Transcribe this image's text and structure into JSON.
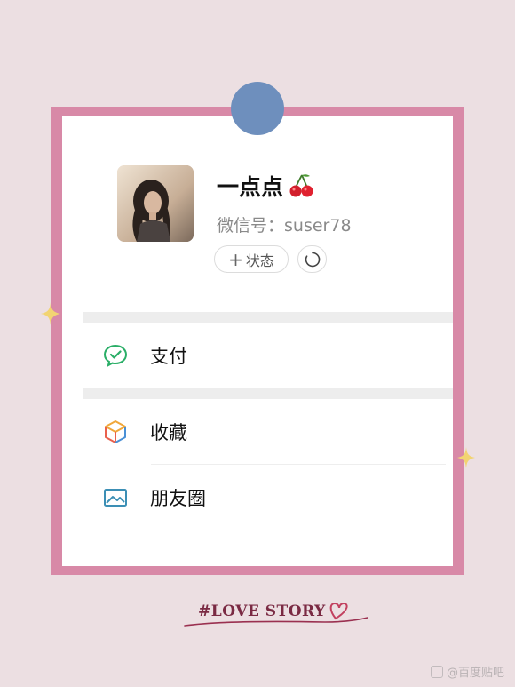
{
  "profile": {
    "nickname": "一点点",
    "nickname_emoji_icon": "cherry-icon",
    "wechat_id_label": "微信号：",
    "wechat_id": "suser78",
    "status_button_label": "状态",
    "status_button_icon": "plus-icon",
    "refresh_icon": "refresh-circle-icon"
  },
  "menu": {
    "pay": {
      "label": "支付",
      "icon": "wechat-pay-icon",
      "icon_color": "#2aae67"
    },
    "favorites": {
      "label": "收藏",
      "icon": "favorites-cube-icon"
    },
    "moments": {
      "label": "朋友圈",
      "icon": "photo-album-icon",
      "icon_color": "#3c8fb5"
    }
  },
  "decoration": {
    "love_story": "#LOVE STORY",
    "frame_color": "#d889a7",
    "pin_color": "#6e8fbd",
    "background_color": "#ecdfe2",
    "sparkle_color": "#f2d472"
  },
  "watermark": {
    "text": "@百度贴吧"
  }
}
